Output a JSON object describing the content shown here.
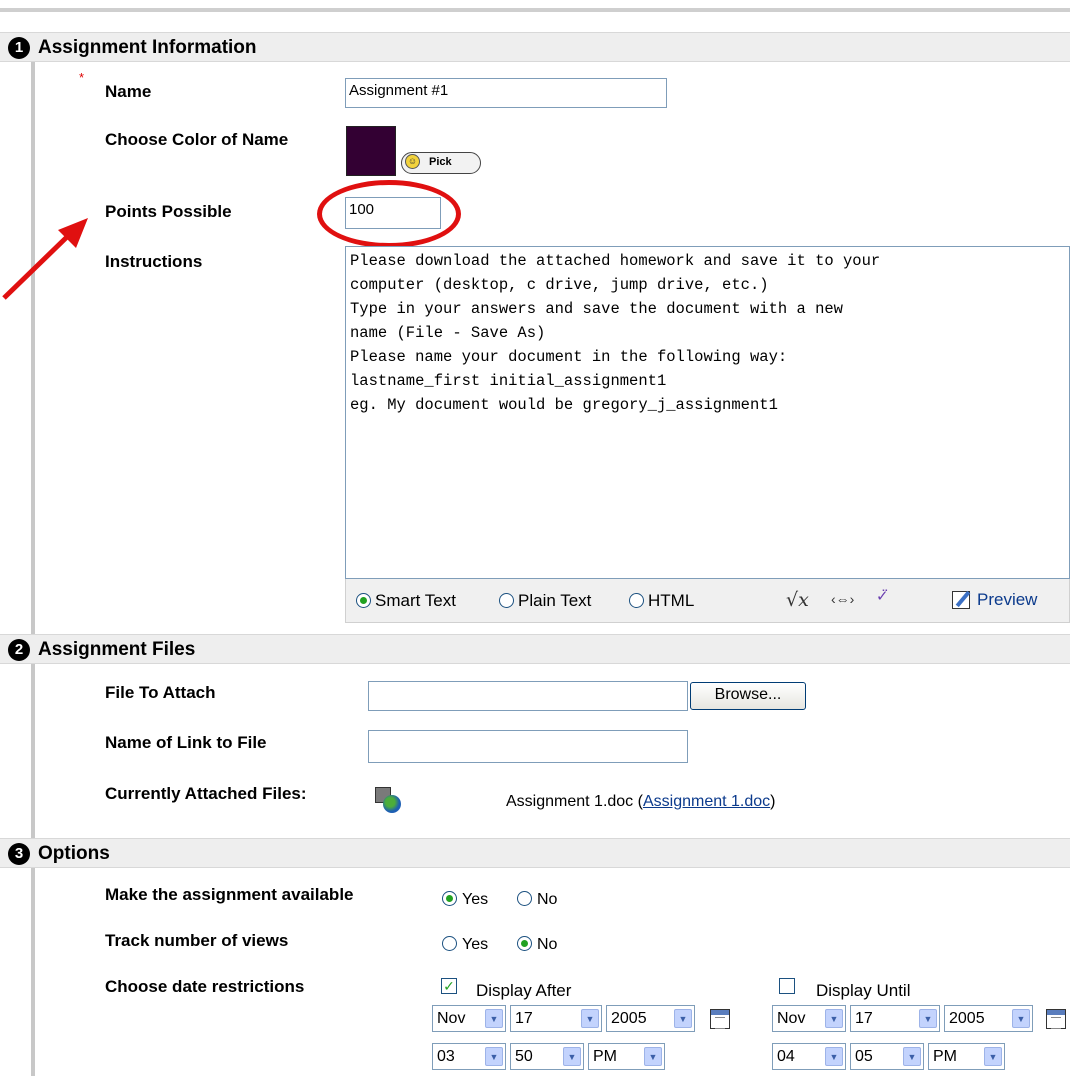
{
  "sections": {
    "s1": {
      "num": "1",
      "title": "Assignment Information"
    },
    "s2": {
      "num": "2",
      "title": "Assignment Files"
    },
    "s3": {
      "num": "3",
      "title": "Options"
    }
  },
  "info": {
    "required_mark": "*",
    "name_label": "Name",
    "name_value": "Assignment #1",
    "color_label": "Choose Color of Name",
    "color_value": "#330033",
    "pick_label": "Pick",
    "points_label": "Points Possible",
    "points_value": "100",
    "instructions_label": "Instructions",
    "instructions_lines": [
      "Please download the attached homework and save it to your",
      "computer (desktop, c drive, jump drive, etc.)",
      "",
      "Type in your answers and save the document with a new",
      "name (File - Save As)",
      "",
      "Please name your document in the following way:",
      "",
      "lastname_first initial_assignment1",
      "",
      "eg. My document would be gregory_j_assignment1"
    ],
    "format_options": [
      "Smart Text",
      "Plain Text",
      "HTML"
    ],
    "format_selected": "Smart Text",
    "toolbar": {
      "equation_icon": "equation-icon",
      "link_icon": "link-icon",
      "spellcheck_icon": "spellcheck-icon",
      "preview_label": "Preview"
    }
  },
  "files": {
    "attach_label": "File To Attach",
    "attach_value": "",
    "browse_label": "Browse...",
    "link_name_label": "Name of Link to File",
    "link_name_value": "",
    "attached_label": "Currently Attached Files:",
    "attached_file": "Assignment 1.doc",
    "attached_open": " (",
    "attached_link": "Assignment 1.doc",
    "attached_close": ")"
  },
  "options": {
    "available_label": "Make the assignment available",
    "available_yes": "Yes",
    "available_no": "No",
    "available_selected": "Yes",
    "views_label": "Track number of views",
    "views_yes": "Yes",
    "views_no": "No",
    "views_selected": "No",
    "date_label": "Choose date restrictions",
    "display_after": {
      "label": "Display After",
      "checked": true,
      "month": "Nov",
      "day": "17",
      "year": "2005",
      "hour": "03",
      "minute": "50",
      "ampm": "PM"
    },
    "display_until": {
      "label": "Display Until",
      "checked": false,
      "month": "Nov",
      "day": "17",
      "year": "2005",
      "hour": "04",
      "minute": "05",
      "ampm": "PM"
    }
  },
  "annotation_colors": {
    "highlight": "#e01010"
  }
}
